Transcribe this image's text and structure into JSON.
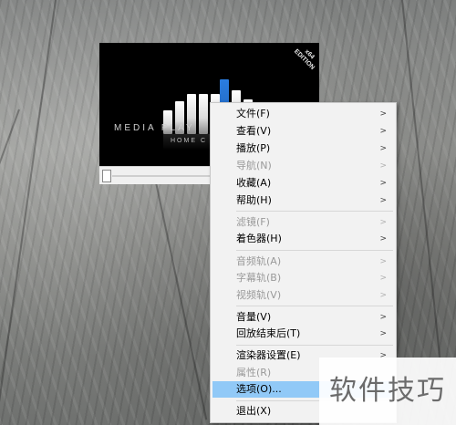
{
  "player": {
    "logo_text": "MEDIA PLAY",
    "logo_subtext": "HOME C",
    "edition_line1": "x64",
    "edition_line2": "EDITION"
  },
  "menu": {
    "items": [
      {
        "label": "文件(F)",
        "enabled": true,
        "submenu": true
      },
      {
        "label": "查看(V)",
        "enabled": true,
        "submenu": true
      },
      {
        "label": "播放(P)",
        "enabled": true,
        "submenu": true
      },
      {
        "label": "导航(N)",
        "enabled": false,
        "submenu": true
      },
      {
        "label": "收藏(A)",
        "enabled": true,
        "submenu": true
      },
      {
        "label": "帮助(H)",
        "enabled": true,
        "submenu": true
      },
      {
        "label": "滤镜(F)",
        "enabled": false,
        "submenu": true
      },
      {
        "label": "着色器(H)",
        "enabled": true,
        "submenu": true
      },
      {
        "label": "音频轨(A)",
        "enabled": false,
        "submenu": true
      },
      {
        "label": "字幕轨(B)",
        "enabled": false,
        "submenu": true
      },
      {
        "label": "视频轨(V)",
        "enabled": false,
        "submenu": true
      },
      {
        "label": "音量(V)",
        "enabled": true,
        "submenu": true
      },
      {
        "label": "回放结束后(T)",
        "enabled": true,
        "submenu": true
      },
      {
        "label": "渲染器设置(E)",
        "enabled": true,
        "submenu": true
      },
      {
        "label": "属性(R)",
        "enabled": false,
        "submenu": false
      },
      {
        "label": "选项(O)...",
        "enabled": true,
        "submenu": false,
        "highlighted": true
      },
      {
        "label": "退出(X)",
        "enabled": true,
        "submenu": false
      }
    ],
    "submenu_arrow": ">"
  },
  "watermark": {
    "text": "软件技巧"
  },
  "colors": {
    "highlight": "#91c9f7",
    "menu_bg": "#f2f2f2",
    "disabled_text": "#9a9a9a",
    "accent_bar": "#2a7de0"
  }
}
